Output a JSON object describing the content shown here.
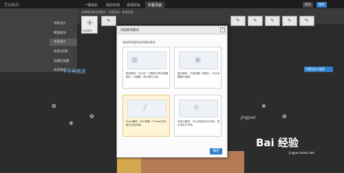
{
  "app": {
    "logo": "空间装扮"
  },
  "tabs": [
    {
      "label": "一键装扮",
      "active": false
    },
    {
      "label": "装扮商城",
      "active": false
    },
    {
      "label": "选择配色",
      "active": false
    },
    {
      "label": "布置页面",
      "active": true
    }
  ],
  "top_buttons": {
    "preview": "预览",
    "save": "保存"
  },
  "sidebar": {
    "items": [
      "导航设计",
      "模板板块",
      "背景设计",
      "装饰(背景)",
      "标题栏设置",
      "日志样式"
    ]
  },
  "toolbar": {
    "tip": "选择模块拖动到框中 · 页面布局 · 新建页面",
    "add_module_label": "添加模块"
  },
  "site": {
    "name": "V不再搞迷",
    "link_box": "设置自定义链接",
    "jingyan": "jingyan"
  },
  "dialog": {
    "title": "添加新的模块",
    "prompt": "请选择您要添加的模块类型",
    "modules": [
      {
        "desc": "图文模块：可以在一个模块中同时放置图片，可编辑，显示图片内容。",
        "icon": "image-text-icon"
      },
      {
        "desc": "图片模块：只能放置一张图片，可以设置图片链接。",
        "icon": "image-icon"
      },
      {
        "desc": "Flash模块：可以放置一个Flash文件，展示动态效果。",
        "icon": "flash-icon"
      },
      {
        "desc": "自定义模块：可以添加自定义内容，显示自定义代码。",
        "icon": "gears-icon"
      }
    ],
    "ok_label": "确定"
  },
  "watermark": {
    "brand": "Bai 经验",
    "url": "jingyan.baidu.com"
  },
  "colors": {
    "accent": "#2f7fc8",
    "dialog_bg": "#fbfbfb",
    "backdrop": "#2c2c2c"
  }
}
